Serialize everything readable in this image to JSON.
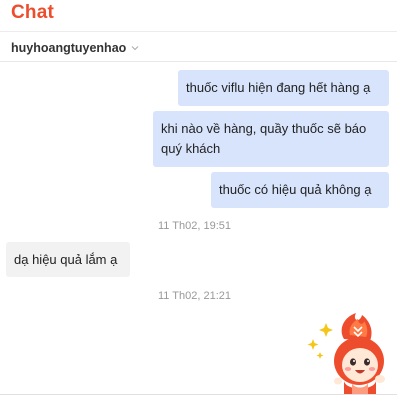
{
  "header": {
    "title": "Chat",
    "contact_name": "huyhoangtuyenhao",
    "accent_color": "#ee4d2d"
  },
  "messages": [
    {
      "direction": "outgoing",
      "text": "thuốc viflu hiện đang hết hàng ạ"
    },
    {
      "direction": "outgoing",
      "text": "khi nào về hàng, quầy thuốc sẽ báo quý khách"
    },
    {
      "direction": "outgoing",
      "text": "thuốc có hiệu quả không ạ"
    },
    {
      "direction": "timestamp",
      "text": "11 Th02, 19:51"
    },
    {
      "direction": "incoming",
      "text": "dạ hiệu quả lắm ạ"
    },
    {
      "direction": "timestamp",
      "text": "11 Th02, 21:21"
    }
  ],
  "icons": {
    "contact_dropdown": "chevron-down-icon",
    "mascot": "shopee-mascot-icon"
  },
  "colors": {
    "outgoing_bubble": "#d7e4fc",
    "incoming_bubble": "#f2f2f2",
    "timestamp": "#999999"
  }
}
